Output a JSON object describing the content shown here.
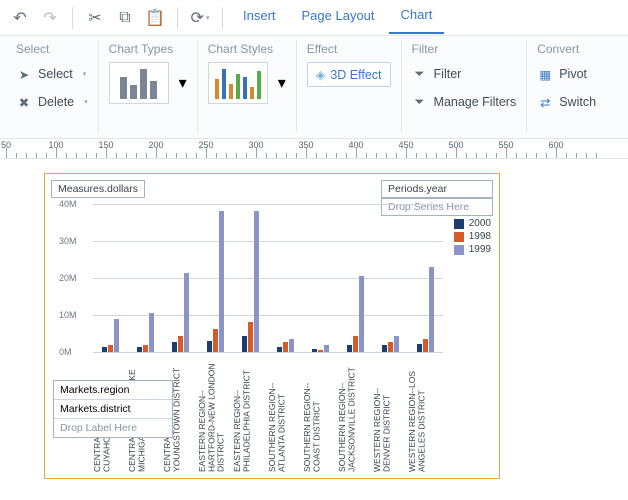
{
  "tabs": {
    "insert": "Insert",
    "pageLayout": "Page Layout",
    "chart": "Chart",
    "active": "chart"
  },
  "ribbon": {
    "select": {
      "title": "Select",
      "select": "Select",
      "delete": "Delete"
    },
    "types": {
      "title": "Chart Types"
    },
    "styles": {
      "title": "Chart Styles"
    },
    "effect": {
      "title": "Effect",
      "btn": "3D Effect"
    },
    "filter": {
      "title": "Filter",
      "filter": "Filter",
      "manage": "Manage Filters"
    },
    "convert": {
      "title": "Convert",
      "pivot": "Pivot",
      "switch": "Switch"
    }
  },
  "ruler": {
    "start": 50,
    "step": 50,
    "count": 12
  },
  "colors": {
    "s2000": "#1d3d6e",
    "s1998": "#d55b2a",
    "s1999": "#8c93c7",
    "frame": "#e0a944"
  },
  "pills": {
    "measure": "Measures.dollars",
    "period": "Periods.year",
    "dropSeries": "Drop Series Here",
    "region": "Markets.region",
    "district": "Markets.district",
    "dropLabel": "Drop Label Here"
  },
  "legend": [
    "2000",
    "1998",
    "1999"
  ],
  "chart_data": {
    "type": "bar",
    "ylabel": "",
    "xlabel": "",
    "ylim": [
      0,
      45000000
    ],
    "yticks": [
      "0M",
      "10M",
      "20M",
      "30M",
      "40M"
    ],
    "categories": [
      "CENTRAL REGION--CUYAHOGA DISTRICT",
      "CENTRAL REGION--LAKE MICHIGAN DISTRICT",
      "CENTRAL REGION--YOUNGSTOWN DISTRICT",
      "EASTERN REGION--HARTFORD-NEW LONDON DISTRICT",
      "EASTERN REGION--PHILADELPHIA DISTRICT",
      "SOUTHERN REGION--ATLANTA DISTRICT",
      "SOUTHERN REGION--COAST DISTRICT",
      "SOUTHERN REGION--JACKSONVILLE DISTRICT",
      "WESTERN REGION--DENVER DISTRICT",
      "WESTERN REGION--LOS ANGELES DISTRICT"
    ],
    "series": [
      {
        "name": "2000",
        "values": [
          1500000,
          1500000,
          3000000,
          3500000,
          5000000,
          1500000,
          1000000,
          2000000,
          2000000,
          2500000
        ]
      },
      {
        "name": "1998",
        "values": [
          2000000,
          2000000,
          5000000,
          7000000,
          9000000,
          3000000,
          500000,
          5000000,
          3000000,
          4000000
        ]
      },
      {
        "name": "1999",
        "values": [
          10000000,
          12000000,
          24000000,
          43000000,
          43000000,
          4000000,
          2000000,
          23000000,
          5000000,
          26000000
        ]
      }
    ]
  }
}
